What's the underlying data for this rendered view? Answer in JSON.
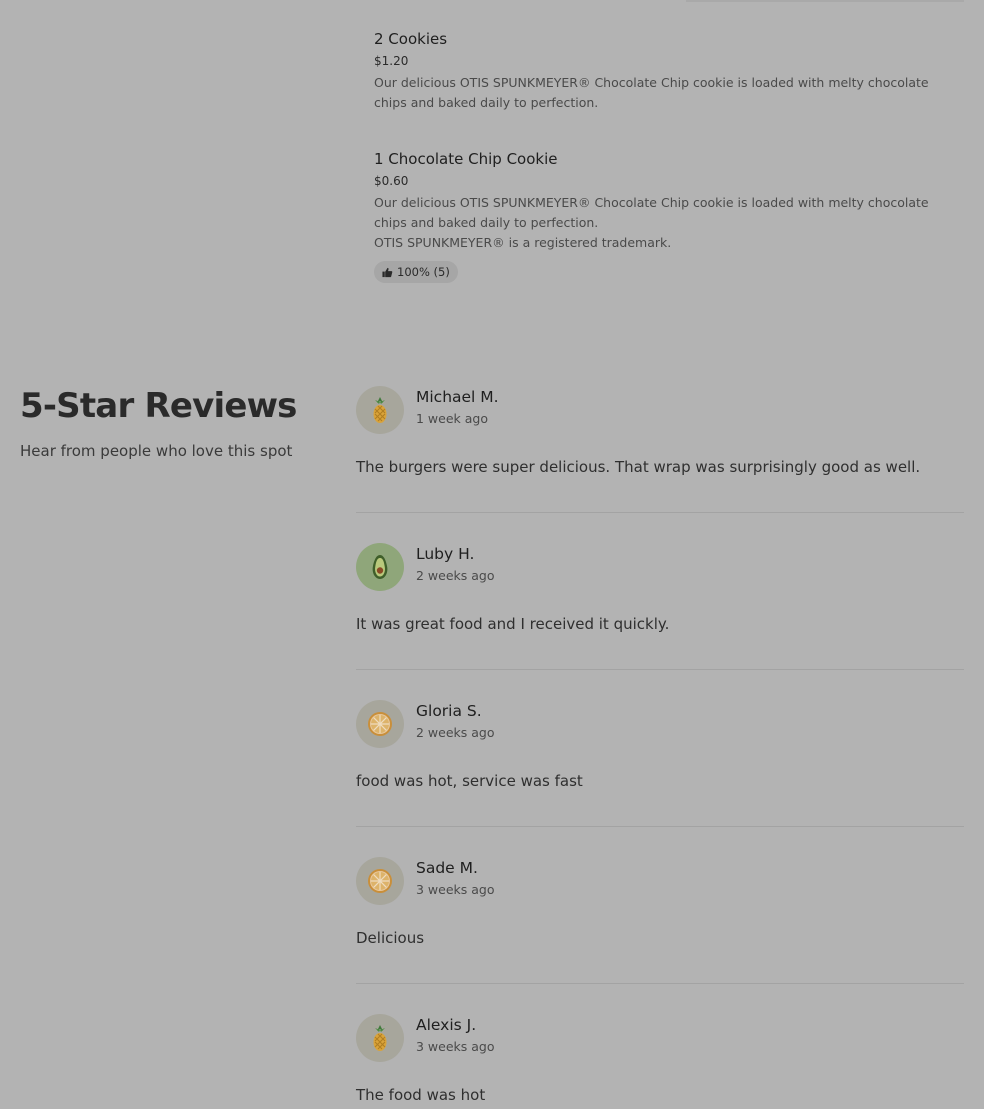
{
  "menu": {
    "items": [
      {
        "name": "2 Cookies",
        "price": "$1.20",
        "description": "Our delicious OTIS SPUNKMEYER® Chocolate Chip cookie is loaded with melty chocolate chips and baked daily to perfection.",
        "note": ""
      },
      {
        "name": "1 Chocolate Chip Cookie",
        "price": "$0.60",
        "description": "Our delicious OTIS SPUNKMEYER® Chocolate Chip cookie is loaded with melty chocolate chips and baked daily to perfection.",
        "note": "OTIS SPUNKMEYER® is a registered trademark.",
        "rating": "100% (5)"
      }
    ]
  },
  "reviews": {
    "heading": "5-Star Reviews",
    "subheading": "Hear from people who love this spot",
    "items": [
      {
        "name": "Michael M.",
        "time": "1 week ago",
        "text": "The burgers were super delicious. That wrap was surprisingly good as well.",
        "avatar_icon": "pineapple-icon"
      },
      {
        "name": "Luby H.",
        "time": "2 weeks ago",
        "text": "It was great food and I received it quickly.",
        "avatar_icon": "avocado-icon"
      },
      {
        "name": "Gloria S.",
        "time": "2 weeks ago",
        "text": "food was hot, service was fast",
        "avatar_icon": "orange-slice-icon"
      },
      {
        "name": "Sade M.",
        "time": "3 weeks ago",
        "text": "Delicious",
        "avatar_icon": "orange-slice-icon"
      },
      {
        "name": "Alexis J.",
        "time": "3 weeks ago",
        "text": "The food was hot",
        "avatar_icon": "pineapple-icon"
      }
    ]
  }
}
